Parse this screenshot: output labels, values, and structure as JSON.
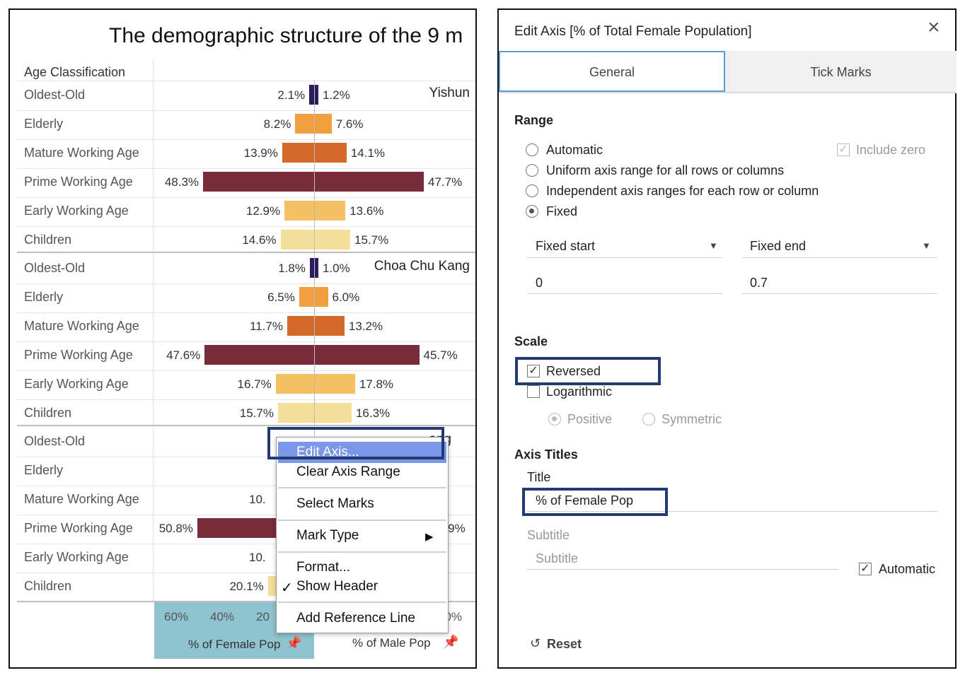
{
  "chart": {
    "title": "The demographic structure of the 9 m",
    "header_label": "Age Classification",
    "age_groups": [
      "Oldest-Old",
      "Elderly",
      "Mature Working Age",
      "Prime Working Age",
      "Early Working Age",
      "Children"
    ],
    "panels": [
      {
        "name": "Yishun",
        "female": [
          "2.1%",
          "8.2%",
          "13.9%",
          "48.3%",
          "12.9%",
          "14.6%"
        ],
        "male": [
          "1.2%",
          "7.6%",
          "14.1%",
          "47.7%",
          "13.6%",
          "15.7%"
        ]
      },
      {
        "name": "Choa Chu Kang",
        "female": [
          "1.8%",
          "6.5%",
          "11.7%",
          "47.6%",
          "16.7%",
          "15.7%"
        ],
        "male": [
          "1.0%",
          "6.0%",
          "13.2%",
          "45.7%",
          "17.8%",
          "16.3%"
        ]
      },
      {
        "name": "ang",
        "female": [
          "",
          "",
          "10.",
          "50.8%",
          "10.",
          "20.1%"
        ],
        "male": [
          "",
          "",
          "",
          "9.9%",
          "",
          ""
        ]
      }
    ],
    "colors": [
      "#2d1b5e",
      "#f0a040",
      "#d2692a",
      "#7a2b3a",
      "#f5c064",
      "#f5dd9a"
    ],
    "axis_female_ticks": [
      "60%",
      "40%",
      "20"
    ],
    "axis_male_ticks": [
      "60%"
    ],
    "axis_female_title": "% of Female Pop",
    "axis_male_title": "% of Male Pop",
    "axis_highlight": "#8fc3cf",
    "pin_icon": "pin-icon"
  },
  "context_menu": {
    "items": {
      "edit_axis": "Edit Axis...",
      "clear_axis_range": "Clear Axis Range",
      "select_marks": "Select Marks",
      "mark_type": "Mark Type",
      "format": "Format...",
      "show_header": "Show Header",
      "add_reference_line": "Add Reference Line"
    },
    "check": "✓",
    "submenu_arrow": "▶",
    "highlight_color": "#7b97e8"
  },
  "dialog": {
    "title": "Edit Axis [% of Total Female Population]",
    "close": "×",
    "tabs": {
      "general": "General",
      "tick_marks": "Tick Marks"
    },
    "range": {
      "heading": "Range",
      "automatic": "Automatic",
      "uniform": "Uniform axis range for all rows or columns",
      "independent": "Independent axis ranges for each row or column",
      "fixed": "Fixed",
      "include_zero": "Include zero",
      "fixed_start_label": "Fixed start",
      "fixed_end_label": "Fixed end",
      "fixed_start_value": "0",
      "fixed_end_value": "0.7",
      "selected": "Fixed"
    },
    "scale": {
      "heading": "Scale",
      "reversed": "Reversed",
      "reversed_checked": true,
      "logarithmic": "Logarithmic",
      "logarithmic_checked": false,
      "positive": "Positive",
      "symmetric": "Symmetric"
    },
    "axis_titles": {
      "heading": "Axis Titles",
      "title_label": "Title",
      "title_value": "% of Female Pop",
      "subtitle_label": "Subtitle",
      "subtitle_placeholder": "Subtitle",
      "automatic": "Automatic",
      "automatic_checked": true
    },
    "reset": "Reset",
    "reset_icon": "↺",
    "highlight_color": "#233a73"
  }
}
